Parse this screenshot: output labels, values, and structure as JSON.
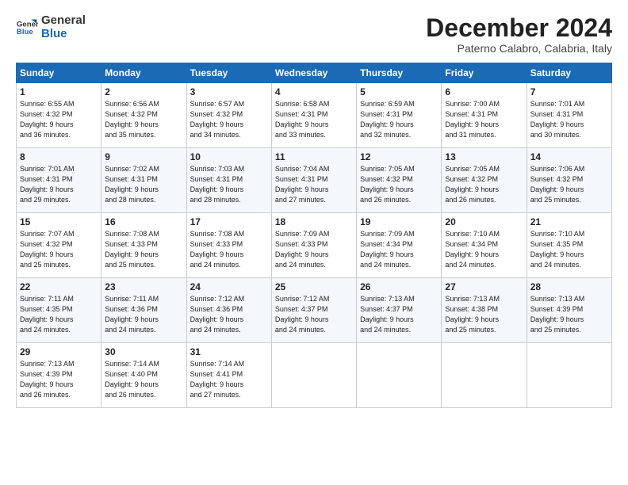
{
  "logo": {
    "line1": "General",
    "line2": "Blue"
  },
  "title": "December 2024",
  "location": "Paterno Calabro, Calabria, Italy",
  "days_of_week": [
    "Sunday",
    "Monday",
    "Tuesday",
    "Wednesday",
    "Thursday",
    "Friday",
    "Saturday"
  ],
  "weeks": [
    [
      {
        "day": 1,
        "info": "Sunrise: 6:55 AM\nSunset: 4:32 PM\nDaylight: 9 hours\nand 36 minutes."
      },
      {
        "day": 2,
        "info": "Sunrise: 6:56 AM\nSunset: 4:32 PM\nDaylight: 9 hours\nand 35 minutes."
      },
      {
        "day": 3,
        "info": "Sunrise: 6:57 AM\nSunset: 4:32 PM\nDaylight: 9 hours\nand 34 minutes."
      },
      {
        "day": 4,
        "info": "Sunrise: 6:58 AM\nSunset: 4:31 PM\nDaylight: 9 hours\nand 33 minutes."
      },
      {
        "day": 5,
        "info": "Sunrise: 6:59 AM\nSunset: 4:31 PM\nDaylight: 9 hours\nand 32 minutes."
      },
      {
        "day": 6,
        "info": "Sunrise: 7:00 AM\nSunset: 4:31 PM\nDaylight: 9 hours\nand 31 minutes."
      },
      {
        "day": 7,
        "info": "Sunrise: 7:01 AM\nSunset: 4:31 PM\nDaylight: 9 hours\nand 30 minutes."
      }
    ],
    [
      {
        "day": 8,
        "info": "Sunrise: 7:01 AM\nSunset: 4:31 PM\nDaylight: 9 hours\nand 29 minutes."
      },
      {
        "day": 9,
        "info": "Sunrise: 7:02 AM\nSunset: 4:31 PM\nDaylight: 9 hours\nand 28 minutes."
      },
      {
        "day": 10,
        "info": "Sunrise: 7:03 AM\nSunset: 4:31 PM\nDaylight: 9 hours\nand 28 minutes."
      },
      {
        "day": 11,
        "info": "Sunrise: 7:04 AM\nSunset: 4:31 PM\nDaylight: 9 hours\nand 27 minutes."
      },
      {
        "day": 12,
        "info": "Sunrise: 7:05 AM\nSunset: 4:32 PM\nDaylight: 9 hours\nand 26 minutes."
      },
      {
        "day": 13,
        "info": "Sunrise: 7:05 AM\nSunset: 4:32 PM\nDaylight: 9 hours\nand 26 minutes."
      },
      {
        "day": 14,
        "info": "Sunrise: 7:06 AM\nSunset: 4:32 PM\nDaylight: 9 hours\nand 25 minutes."
      }
    ],
    [
      {
        "day": 15,
        "info": "Sunrise: 7:07 AM\nSunset: 4:32 PM\nDaylight: 9 hours\nand 25 minutes."
      },
      {
        "day": 16,
        "info": "Sunrise: 7:08 AM\nSunset: 4:33 PM\nDaylight: 9 hours\nand 25 minutes."
      },
      {
        "day": 17,
        "info": "Sunrise: 7:08 AM\nSunset: 4:33 PM\nDaylight: 9 hours\nand 24 minutes."
      },
      {
        "day": 18,
        "info": "Sunrise: 7:09 AM\nSunset: 4:33 PM\nDaylight: 9 hours\nand 24 minutes."
      },
      {
        "day": 19,
        "info": "Sunrise: 7:09 AM\nSunset: 4:34 PM\nDaylight: 9 hours\nand 24 minutes."
      },
      {
        "day": 20,
        "info": "Sunrise: 7:10 AM\nSunset: 4:34 PM\nDaylight: 9 hours\nand 24 minutes."
      },
      {
        "day": 21,
        "info": "Sunrise: 7:10 AM\nSunset: 4:35 PM\nDaylight: 9 hours\nand 24 minutes."
      }
    ],
    [
      {
        "day": 22,
        "info": "Sunrise: 7:11 AM\nSunset: 4:35 PM\nDaylight: 9 hours\nand 24 minutes."
      },
      {
        "day": 23,
        "info": "Sunrise: 7:11 AM\nSunset: 4:36 PM\nDaylight: 9 hours\nand 24 minutes."
      },
      {
        "day": 24,
        "info": "Sunrise: 7:12 AM\nSunset: 4:36 PM\nDaylight: 9 hours\nand 24 minutes."
      },
      {
        "day": 25,
        "info": "Sunrise: 7:12 AM\nSunset: 4:37 PM\nDaylight: 9 hours\nand 24 minutes."
      },
      {
        "day": 26,
        "info": "Sunrise: 7:13 AM\nSunset: 4:37 PM\nDaylight: 9 hours\nand 24 minutes."
      },
      {
        "day": 27,
        "info": "Sunrise: 7:13 AM\nSunset: 4:38 PM\nDaylight: 9 hours\nand 25 minutes."
      },
      {
        "day": 28,
        "info": "Sunrise: 7:13 AM\nSunset: 4:39 PM\nDaylight: 9 hours\nand 25 minutes."
      }
    ],
    [
      {
        "day": 29,
        "info": "Sunrise: 7:13 AM\nSunset: 4:39 PM\nDaylight: 9 hours\nand 26 minutes."
      },
      {
        "day": 30,
        "info": "Sunrise: 7:14 AM\nSunset: 4:40 PM\nDaylight: 9 hours\nand 26 minutes."
      },
      {
        "day": 31,
        "info": "Sunrise: 7:14 AM\nSunset: 4:41 PM\nDaylight: 9 hours\nand 27 minutes."
      },
      null,
      null,
      null,
      null
    ]
  ]
}
